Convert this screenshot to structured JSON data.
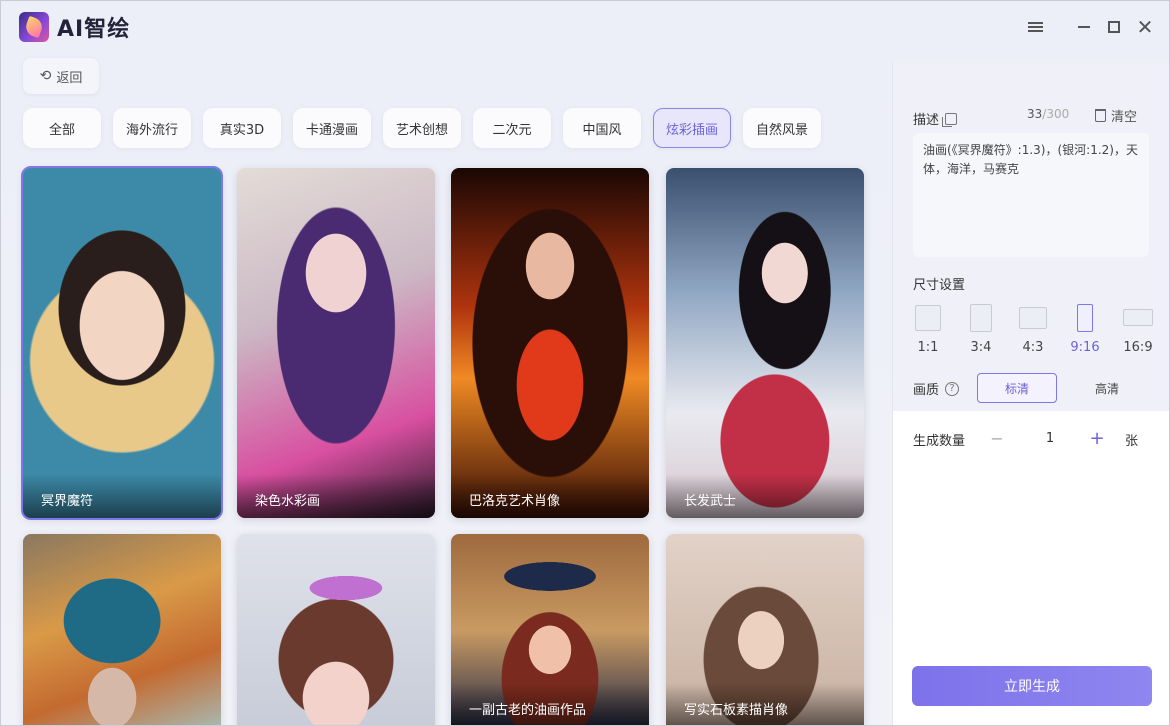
{
  "app": {
    "title": "AI智绘"
  },
  "header": {
    "back_label": "返回"
  },
  "tabs": [
    {
      "label": "全部"
    },
    {
      "label": "海外流行"
    },
    {
      "label": "真实3D"
    },
    {
      "label": "卡通漫画"
    },
    {
      "label": "艺术创想"
    },
    {
      "label": "二次元"
    },
    {
      "label": "中国风"
    },
    {
      "label": "炫彩插画",
      "active": true
    },
    {
      "label": "自然风景"
    }
  ],
  "gallery": [
    {
      "caption": "冥界魔符",
      "selected": true
    },
    {
      "caption": "染色水彩画"
    },
    {
      "caption": "巴洛克艺术肖像"
    },
    {
      "caption": "长发武士"
    },
    {
      "caption": ""
    },
    {
      "caption": ""
    },
    {
      "caption": "一副古老的油画作品"
    },
    {
      "caption": "写实石板素描肖像"
    }
  ],
  "panel": {
    "desc_label": "描述",
    "counter_current": "33",
    "counter_max": "/300",
    "clear_label": "清空",
    "description": "油画(《冥界魔符》:1.3)，(银河:1.2)，天体，海洋，马赛克",
    "size_label": "尺寸设置",
    "ratios": [
      {
        "label": "1:1"
      },
      {
        "label": "3:4"
      },
      {
        "label": "4:3"
      },
      {
        "label": "9:16",
        "active": true
      },
      {
        "label": "16:9"
      }
    ],
    "quality_label": "画质",
    "quality_options": {
      "standard": "标清",
      "high": "高清"
    },
    "count_label": "生成数量",
    "count_value": "1",
    "minus_label": "−",
    "plus_label": "+",
    "count_unit": "张",
    "generate_label": "立即生成"
  },
  "colors": {
    "accent": "#7f76e8",
    "accent_text": "#6b62d8"
  }
}
